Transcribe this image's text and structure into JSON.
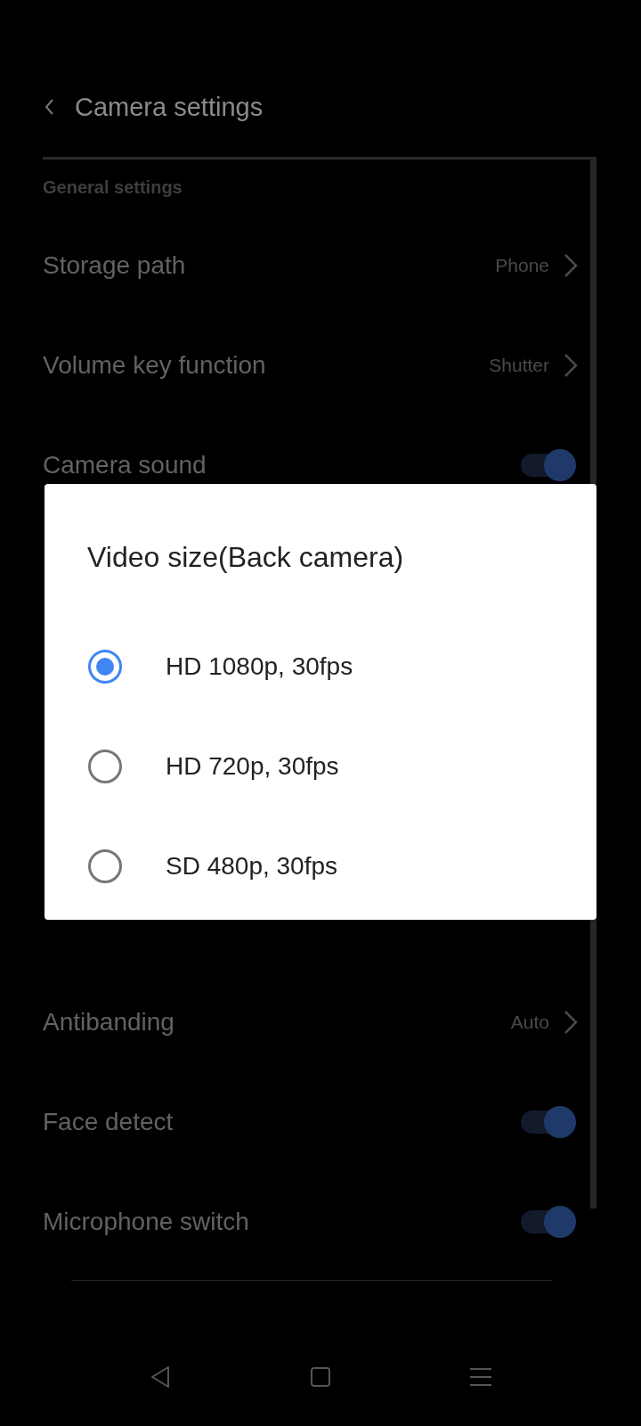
{
  "header": {
    "title": "Camera settings"
  },
  "section": {
    "title": "General settings"
  },
  "rows_top": [
    {
      "kind": "link",
      "label": "Storage path",
      "value": "Phone"
    },
    {
      "kind": "link",
      "label": "Volume key function",
      "value": "Shutter"
    },
    {
      "kind": "toggle",
      "label": "Camera sound",
      "on": true
    }
  ],
  "rows_bottom": [
    {
      "kind": "link",
      "label": "Antibanding",
      "value": "Auto"
    },
    {
      "kind": "toggle",
      "label": "Face detect",
      "on": true
    },
    {
      "kind": "toggle",
      "label": "Microphone switch",
      "on": true
    }
  ],
  "dialog": {
    "title": "Video size(Back camera)",
    "options": [
      {
        "label": "HD 1080p, 30fps",
        "selected": true
      },
      {
        "label": "HD 720p, 30fps",
        "selected": false
      },
      {
        "label": "SD 480p, 30fps",
        "selected": false
      }
    ]
  }
}
